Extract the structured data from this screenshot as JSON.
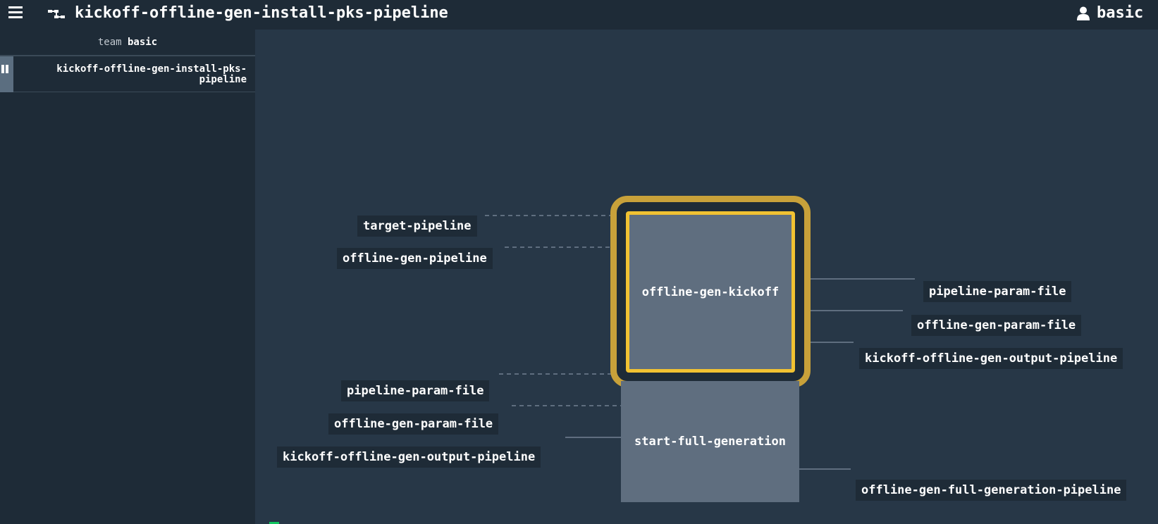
{
  "header": {
    "title": "kickoff-offline-gen-install-pks-pipeline",
    "menu_icon": "hamburger-menu-icon",
    "pipeline_icon": "pipeline-icon",
    "user": {
      "name": "basic",
      "icon": "user-icon"
    }
  },
  "sidebar": {
    "team_prefix": "team",
    "team_name": "basic",
    "pipelines": [
      {
        "label": "kickoff-offline-gen-install-pks-pipeline",
        "icon": "pause-icon"
      }
    ]
  },
  "pipeline": {
    "jobs": {
      "kickoff": {
        "label": "offline-gen-kickoff",
        "highlight_color": "#f1c232"
      },
      "full_generation": {
        "label": "start-full-generation"
      }
    },
    "kickoff_inputs": [
      "target-pipeline",
      "offline-gen-pipeline"
    ],
    "kickoff_outputs": [
      "pipeline-param-file",
      "offline-gen-param-file",
      "kickoff-offline-gen-output-pipeline"
    ],
    "full_generation_inputs": [
      "pipeline-param-file",
      "offline-gen-param-file",
      "kickoff-offline-gen-output-pipeline"
    ],
    "full_generation_outputs": [
      "offline-gen-full-generation-pipeline"
    ]
  },
  "colors": {
    "background": "#273747",
    "panel": "#1e2b37",
    "job": "#5f6e7f",
    "running_border": "#c8a13a",
    "succeeded": "#11c560"
  }
}
